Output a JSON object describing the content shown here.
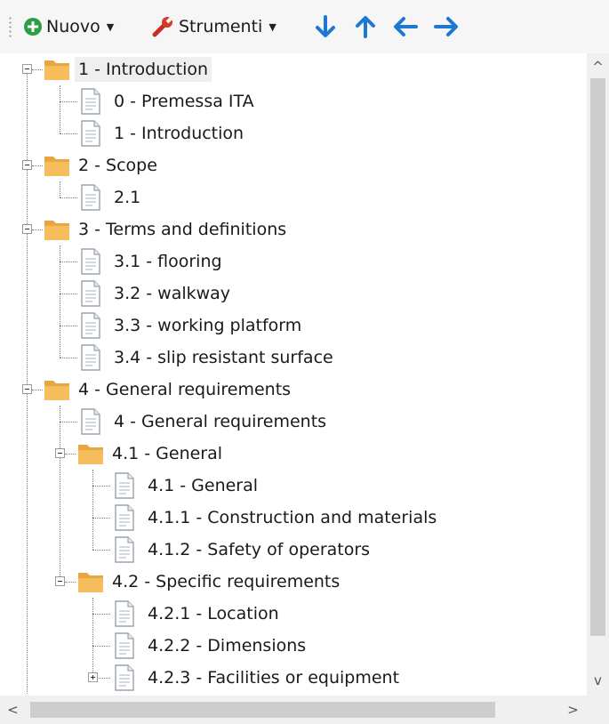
{
  "toolbar": {
    "new_label": "Nuovo",
    "tools_label": "Strumenti",
    "icons": [
      "plus-circle-icon",
      "wrench-icon",
      "arrow-down-icon",
      "arrow-up-icon",
      "arrow-left-icon",
      "arrow-right-icon"
    ]
  },
  "tree": {
    "nodes": [
      {
        "label": "1 - Introduction",
        "type": "folder",
        "expanded": true,
        "selected": true
      },
      {
        "label": "0 - Premessa ITA",
        "type": "document"
      },
      {
        "label": "1 - Introduction",
        "type": "document"
      },
      {
        "label": "2 - Scope",
        "type": "folder",
        "expanded": true
      },
      {
        "label": "2.1",
        "type": "document"
      },
      {
        "label": "3 - Terms  and definitions",
        "type": "folder",
        "expanded": true
      },
      {
        "label": "3.1 - flooring",
        "type": "document"
      },
      {
        "label": "3.2 - walkway",
        "type": "document"
      },
      {
        "label": "3.3 - working  platform",
        "type": "document"
      },
      {
        "label": "3.4 - slip resistant surface",
        "type": "document"
      },
      {
        "label": "4 - General requirements",
        "type": "folder",
        "expanded": true
      },
      {
        "label": "4 - General requirements",
        "type": "document"
      },
      {
        "label": "4.1 - General",
        "type": "folder",
        "expanded": true
      },
      {
        "label": "4.1 - General",
        "type": "document"
      },
      {
        "label": "4.1.1 - Construction and materials",
        "type": "document"
      },
      {
        "label": "4.1.2 - Safety of operators",
        "type": "document"
      },
      {
        "label": "4.2 -  Specific  requirements",
        "type": "folder",
        "expanded": true
      },
      {
        "label": "4.2.1 - Location",
        "type": "document"
      },
      {
        "label": "4.2.2 - Dimensions",
        "type": "document"
      },
      {
        "label": "4.2.3 - Facilities or equipment",
        "type": "document",
        "collapsed_children": true
      }
    ]
  },
  "scrollbars": {
    "up_arrow": "^",
    "down_arrow": "v",
    "left_arrow": "<",
    "right_arrow": ">"
  },
  "colors": {
    "folder": "#f0b04a",
    "arrows": "#1e78d2",
    "new_icon": "#2e9e44",
    "wrench": "#d23a2a"
  }
}
